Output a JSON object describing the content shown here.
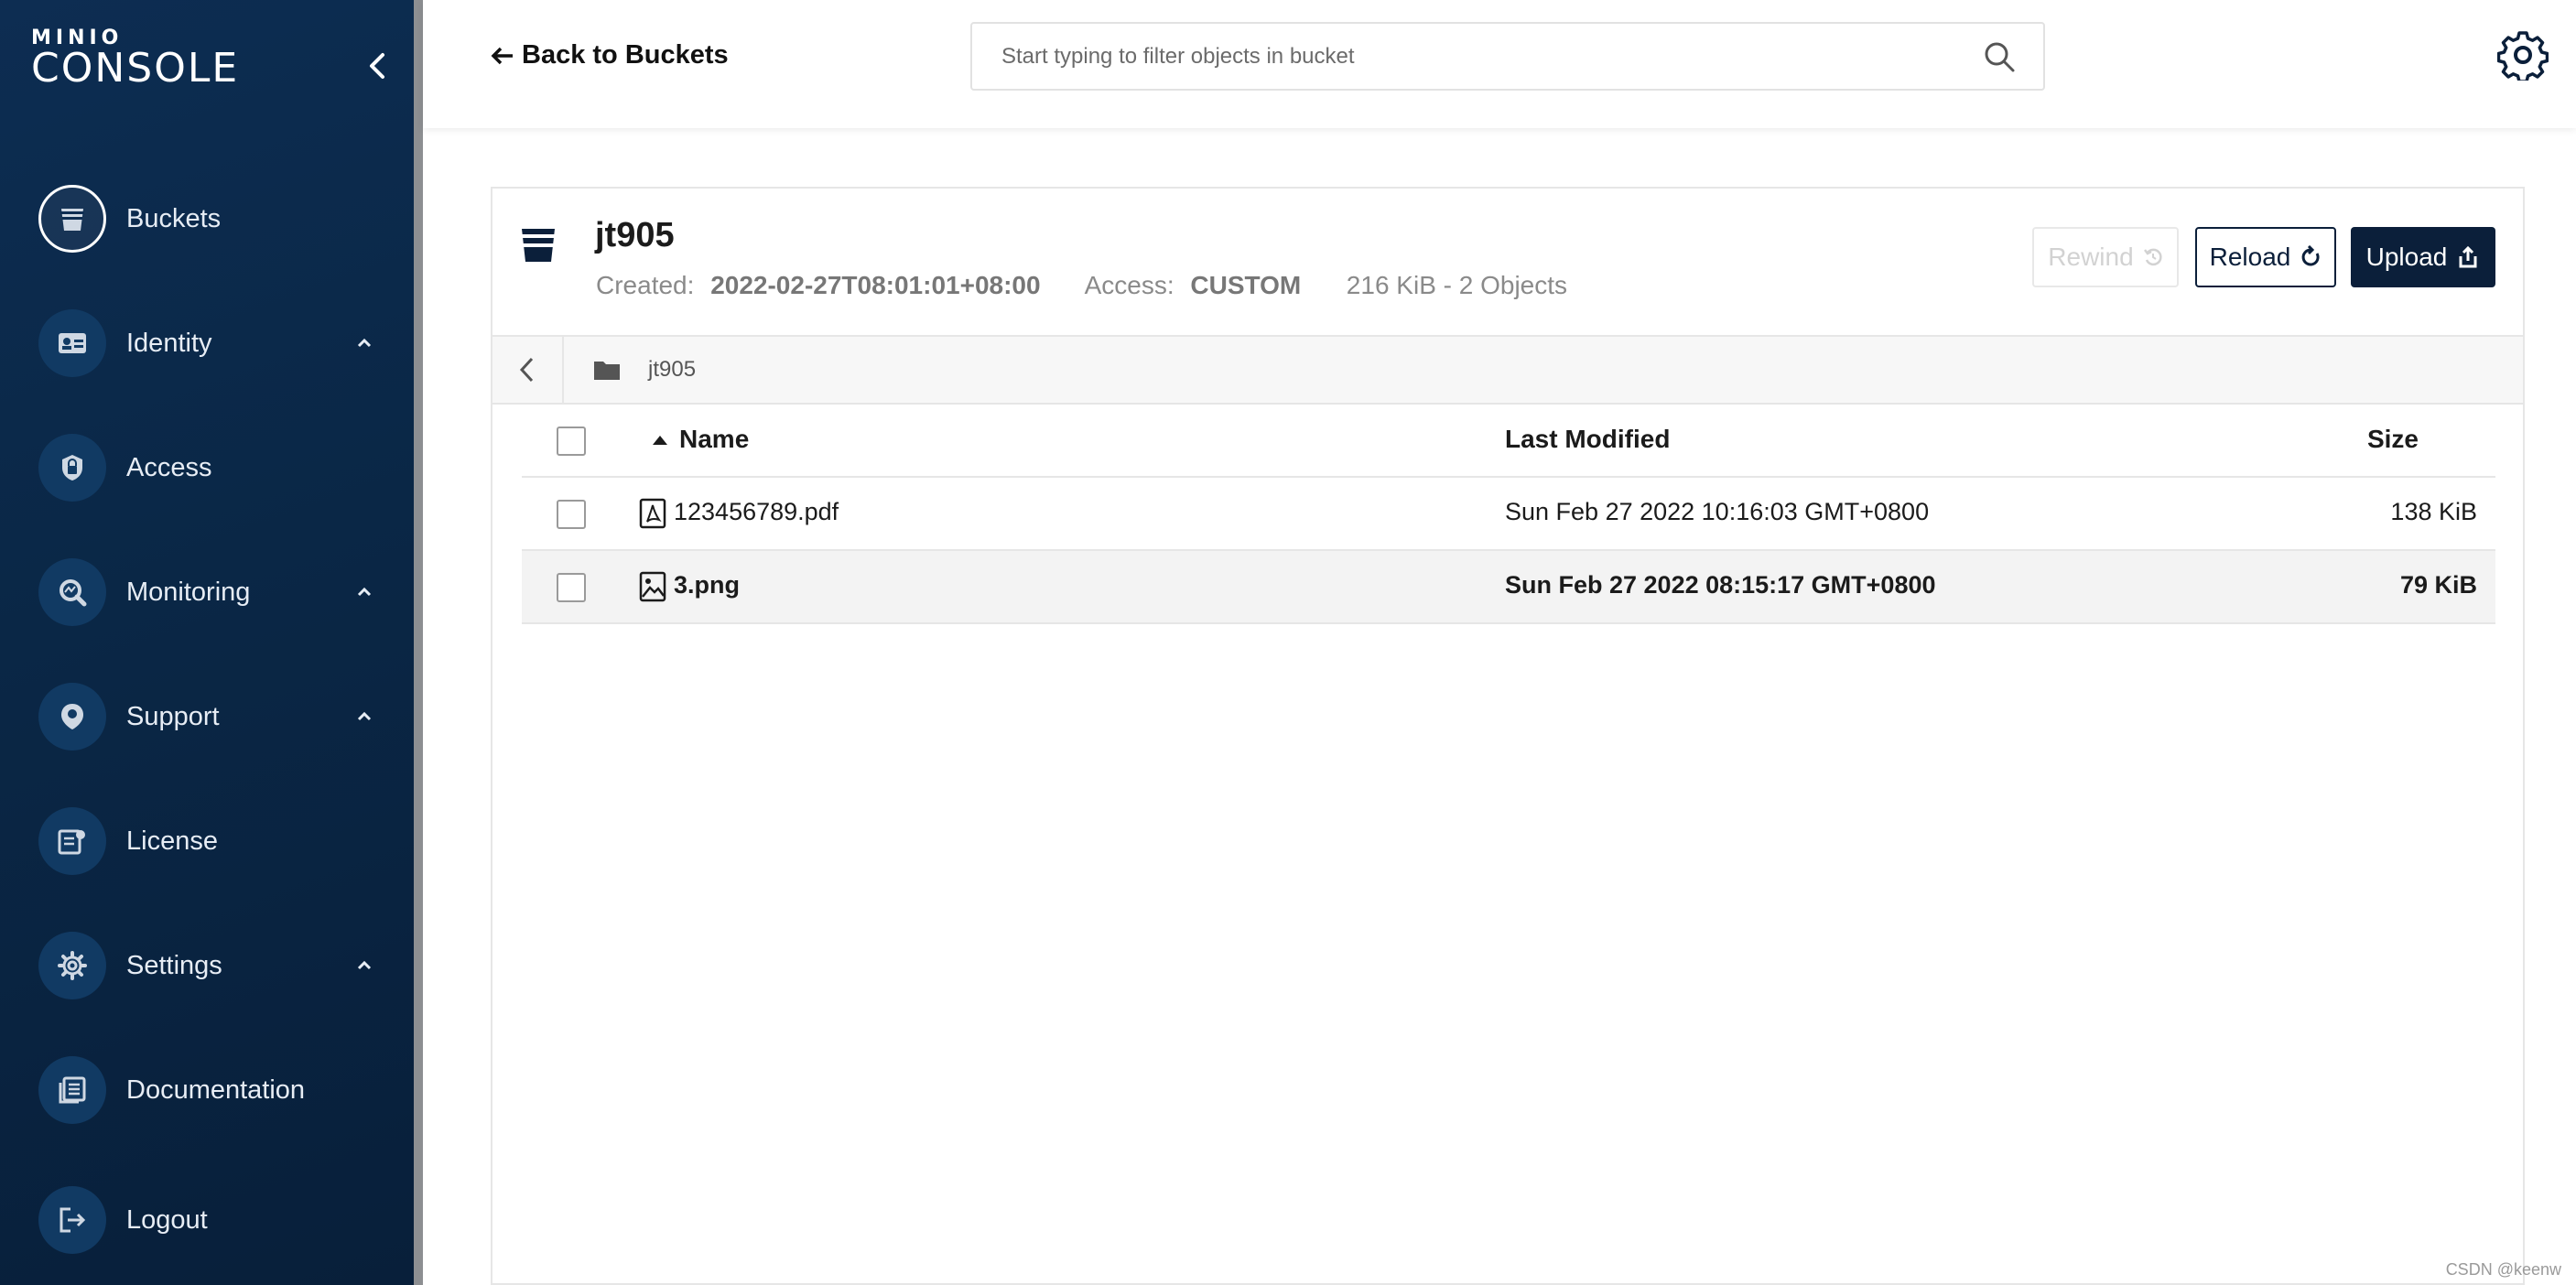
{
  "brand": {
    "line1": "MINIO",
    "line2": "CONSOLE"
  },
  "sidebar": {
    "items": [
      {
        "label": "Buckets",
        "icon": "bucket-icon",
        "active": true,
        "expandable": false
      },
      {
        "label": "Identity",
        "icon": "id-card-icon",
        "expandable": true
      },
      {
        "label": "Access",
        "icon": "lock-icon",
        "expandable": false
      },
      {
        "label": "Monitoring",
        "icon": "monitoring-icon",
        "expandable": true
      },
      {
        "label": "Support",
        "icon": "support-icon",
        "expandable": true
      },
      {
        "label": "License",
        "icon": "license-icon",
        "expandable": false
      },
      {
        "label": "Settings",
        "icon": "gear-icon",
        "expandable": true
      },
      {
        "label": "Documentation",
        "icon": "documentation-icon",
        "expandable": false
      },
      {
        "label": "Logout",
        "icon": "logout-icon",
        "expandable": false
      }
    ]
  },
  "topbar": {
    "back_label": "Back to Buckets",
    "search_placeholder": "Start typing to filter objects in bucket",
    "settings_icon": "gear-icon"
  },
  "bucket": {
    "name": "jt905",
    "created_label": "Created:",
    "created_value": "2022-02-27T08:01:01+08:00",
    "access_label": "Access:",
    "access_value": "CUSTOM",
    "summary": "216 KiB - 2 Objects"
  },
  "actions": {
    "rewind": "Rewind",
    "reload": "Reload",
    "upload": "Upload"
  },
  "breadcrumb": {
    "path": "jt905"
  },
  "table": {
    "columns": {
      "name": "Name",
      "last_modified": "Last Modified",
      "size": "Size"
    },
    "rows": [
      {
        "name": "123456789.pdf",
        "type": "pdf",
        "last_modified": "Sun Feb 27 2022 10:16:03 GMT+0800",
        "size": "138 KiB",
        "highlighted": false
      },
      {
        "name": "3.png",
        "type": "image",
        "last_modified": "Sun Feb 27 2022 08:15:17 GMT+0800",
        "size": "79 KiB",
        "highlighted": true
      }
    ]
  },
  "colors": {
    "sidebar_bg": "#0a2746",
    "primary": "#0b1f3a",
    "accent_border": "#8d8f92"
  },
  "watermark": "CSDN @keenw"
}
